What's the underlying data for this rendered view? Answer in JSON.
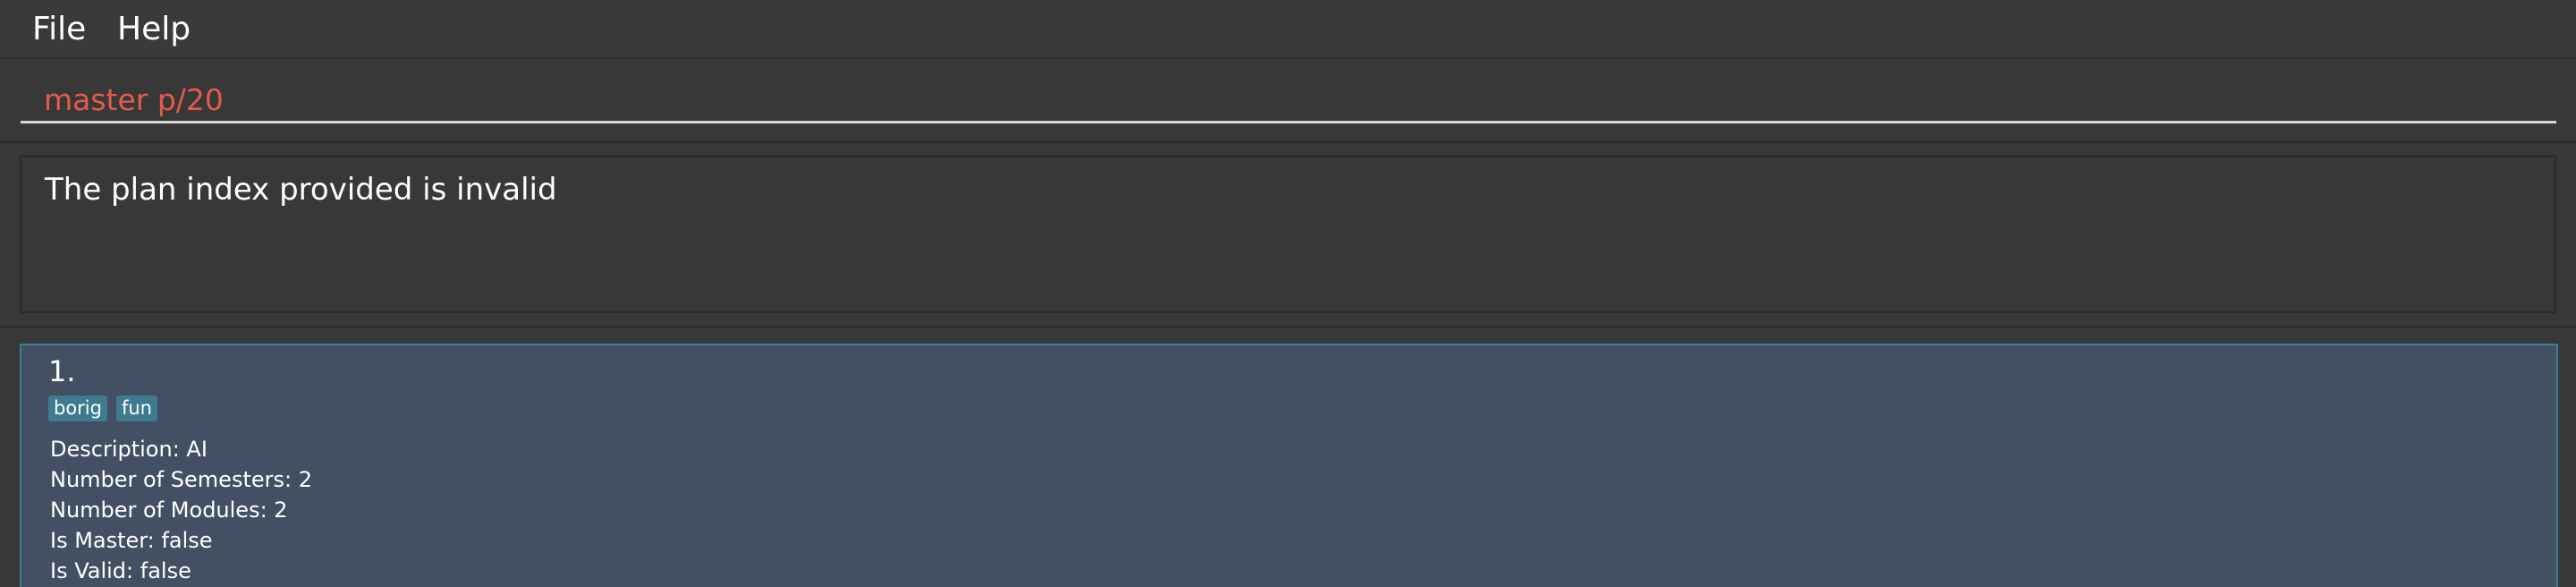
{
  "menu": {
    "file_label": "File",
    "help_label": "Help"
  },
  "command": {
    "value": "master p/20",
    "text_color": "#e35b4a"
  },
  "result": {
    "message": "The plan index provided is invalid"
  },
  "plans": [
    {
      "index": "1.",
      "tags": [
        "borig",
        "fun"
      ],
      "description": "Description: AI",
      "semesters": "Number of Semesters: 2",
      "modules": "Number of Modules: 2",
      "is_master": "Is Master: false",
      "is_valid": "Is Valid: false"
    }
  ],
  "colors": {
    "background": "#383838",
    "card_background": "#435063",
    "card_border": "#3d7e94",
    "tag_background": "#3e7b91"
  }
}
